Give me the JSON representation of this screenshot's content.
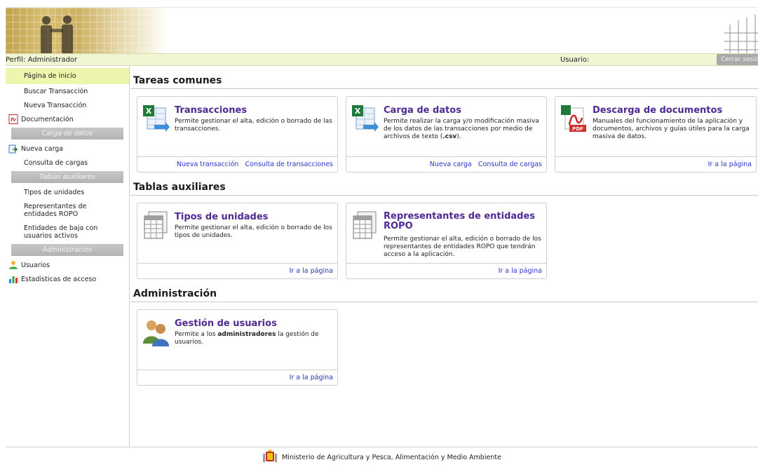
{
  "header": {
    "profile": "Perfil: Administrador",
    "user_label": "Usuario:",
    "logout": "Cerrar sesión"
  },
  "sidebar": {
    "items_top": [
      {
        "label": "Página de inicio",
        "active": true
      },
      {
        "label": "Buscar Transacción"
      },
      {
        "label": "Nueva Transacción"
      },
      {
        "label": "Documentación",
        "icon": "pdf-icon"
      }
    ],
    "section_carga": "Carga de datos",
    "items_carga": [
      {
        "label": "Nueva carga",
        "icon": "upload-icon"
      },
      {
        "label": "Consulta de cargas"
      }
    ],
    "section_tablas": "Tablas auxiliares",
    "items_tablas": [
      {
        "label": "Tipos de unidades"
      },
      {
        "label": "Representantes de entidades ROPO"
      },
      {
        "label": "Entidades de baja con usuarios activos"
      }
    ],
    "section_admin": "Administración",
    "items_admin": [
      {
        "label": "Usuarios",
        "icon": "users-icon"
      },
      {
        "label": "Estadísticas de acceso",
        "icon": "bar-chart-icon"
      }
    ]
  },
  "sections": {
    "tareas": "Tareas comunes",
    "tablas": "Tablas auxiliares",
    "admin": "Administración"
  },
  "cards": {
    "transacciones": {
      "title": "Transacciones",
      "desc": "Permite gestionar el alta, edición o borrado de las transacciones.",
      "link1": "Nueva transacción",
      "link2": "Consulta de transacciones"
    },
    "carga": {
      "title": "Carga de datos",
      "desc_a": "Permite realizar la carga y/o modificación masiva de los datos de las transacciones por medio de archivos de texto (",
      "desc_b": ".csv",
      "desc_c": ").",
      "link1": "Nueva carga",
      "link2": "Consulta de cargas"
    },
    "descarga": {
      "title": "Descarga de documentos",
      "desc": "Manuales del funcionamiento de la aplicación y documentos, archivos y guías útiles para la carga masiva de datos.",
      "link": "Ir a la página"
    },
    "tipos": {
      "title": "Tipos de unidades",
      "desc": "Permite gestionar el alta, edición o borrado de los tipos de unidades.",
      "link": "Ir a la página"
    },
    "representantes": {
      "title": "Representantes de entidades ROPO",
      "desc": "Permite gestionar el alta, edición o borrado de los representantes de entidades ROPO que tendrán acceso a la aplicación.",
      "link": "Ir a la página"
    },
    "usuarios": {
      "title": "Gestión de usuarios",
      "desc_a": "Permite a los ",
      "desc_b": "administradores",
      "desc_c": " la gestión de usuarios.",
      "link": "Ir a la página"
    }
  },
  "footer": {
    "text": "Ministerio de Agricultura y Pesca, Alimentación y Medio Ambiente"
  },
  "colors": {
    "card_title": "#4f2a93",
    "link": "#2b34c9",
    "active_item": "#eef6ad",
    "profile_bar": "#f2f5d3"
  }
}
